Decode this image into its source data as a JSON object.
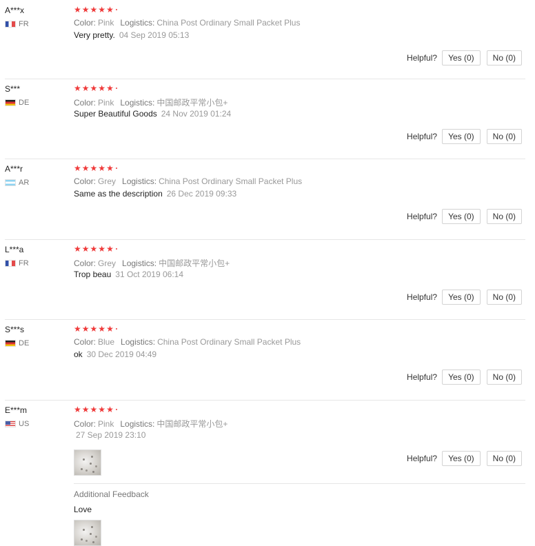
{
  "helpful_label": "Helpful?",
  "color_key": "Color:",
  "logistics_key": "Logistics:",
  "reviews": [
    {
      "user": "A***x",
      "country": "FR",
      "stars": 5,
      "color": "Pink",
      "logistics": "China Post Ordinary Small Packet Plus",
      "text": "Very pretty.",
      "date": "04 Sep 2019 05:13",
      "yes": "Yes (0)",
      "no": "No (0)"
    },
    {
      "user": "S***",
      "country": "DE",
      "stars": 5,
      "color": "Pink",
      "logistics": "中国邮政平常小包+",
      "text": "Super Beautiful Goods",
      "date": "24 Nov 2019 01:24",
      "yes": "Yes (0)",
      "no": "No (0)"
    },
    {
      "user": "A***r",
      "country": "AR",
      "stars": 5,
      "color": "Grey",
      "logistics": "China Post Ordinary Small Packet Plus",
      "text": "Same as the description",
      "date": "26 Dec 2019 09:33",
      "yes": "Yes (0)",
      "no": "No (0)"
    },
    {
      "user": "L***a",
      "country": "FR",
      "stars": 5,
      "color": "Grey",
      "logistics": "中国邮政平常小包+",
      "text": "Trop beau",
      "date": "31 Oct 2019 06:14",
      "yes": "Yes (0)",
      "no": "No (0)"
    },
    {
      "user": "S***s",
      "country": "DE",
      "stars": 5,
      "color": "Blue",
      "logistics": "China Post Ordinary Small Packet Plus",
      "text": "ok",
      "date": "30 Dec 2019 04:49",
      "yes": "Yes (0)",
      "no": "No (0)"
    },
    {
      "user": "E***m",
      "country": "US",
      "stars": 5,
      "color": "Pink",
      "logistics": "中国邮政平常小包+",
      "text": "",
      "date": "27 Sep 2019 23:10",
      "yes": "Yes (0)",
      "no": "No (0)",
      "additional_feedback": {
        "title": "Additional Feedback",
        "text": "Love"
      }
    }
  ]
}
